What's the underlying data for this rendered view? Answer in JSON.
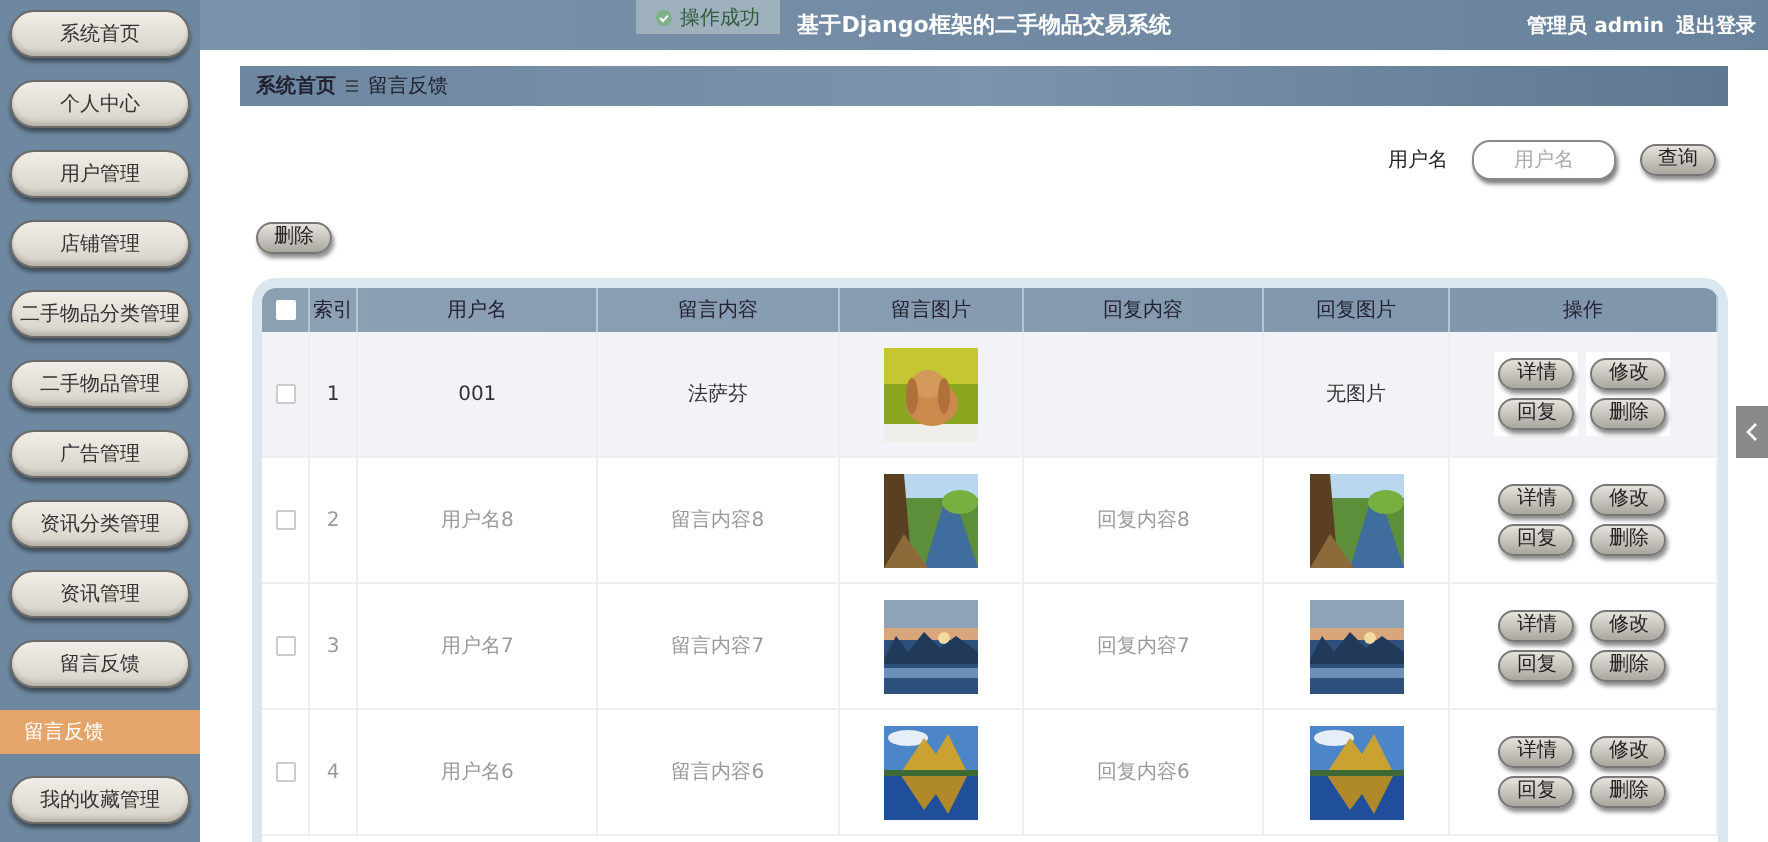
{
  "header": {
    "title": "基于Django框架的二手物品交易系统",
    "user": "管理员 admin",
    "logout": "退出登录"
  },
  "toast": {
    "text": "操作成功"
  },
  "sidebar": {
    "items": [
      {
        "label": "系统首页",
        "kind": "button",
        "selected": false
      },
      {
        "label": "个人中心",
        "kind": "button",
        "selected": false
      },
      {
        "label": "用户管理",
        "kind": "button",
        "selected": false
      },
      {
        "label": "店铺管理",
        "kind": "button",
        "selected": false
      },
      {
        "label": "二手物品分类管理",
        "kind": "button",
        "selected": false
      },
      {
        "label": "二手物品管理",
        "kind": "button",
        "selected": false
      },
      {
        "label": "广告管理",
        "kind": "button",
        "selected": false
      },
      {
        "label": "资讯分类管理",
        "kind": "button",
        "selected": false
      },
      {
        "label": "资讯管理",
        "kind": "button",
        "selected": false
      },
      {
        "label": "留言反馈",
        "kind": "button",
        "selected": false
      },
      {
        "label": "留言反馈",
        "kind": "subitem",
        "selected": true
      },
      {
        "label": "我的收藏管理",
        "kind": "button",
        "selected": false
      }
    ]
  },
  "breadcrumb": [
    "系统首页",
    "留言反馈"
  ],
  "search": {
    "label": "用户名",
    "placeholder": "用户名",
    "button": "查询"
  },
  "delete_button": "删除",
  "table": {
    "columns": [
      "索引",
      "用户名",
      "留言内容",
      "留言图片",
      "回复内容",
      "回复图片",
      "操作"
    ],
    "all_checked": false,
    "rows": [
      {
        "index": "1",
        "username": "001",
        "content": "法萨芬",
        "reply_image": {
          "kind": "none",
          "text": "无图片"
        },
        "checked": false,
        "hovered": true,
        "actions": [
          "详情",
          "修改",
          "回复",
          "删除"
        ]
      },
      {
        "index": "2",
        "username": "用户名8",
        "content": "留言内容8",
        "reply": "回复内容8",
        "checked": false,
        "hovered": false,
        "actions": [
          "详情",
          "修改",
          "回复",
          "删除"
        ]
      },
      {
        "index": "3",
        "username": "用户名7",
        "content": "留言内容7",
        "reply": "回复内容7",
        "checked": false,
        "hovered": false,
        "actions": [
          "详情",
          "修改",
          "回复",
          "删除"
        ]
      },
      {
        "index": "4",
        "username": "用户名6",
        "content": "留言内容6",
        "reply": "回复内容6",
        "checked": false,
        "hovered": false,
        "actions": [
          "详情",
          "修改",
          "回复",
          "删除"
        ]
      }
    ]
  }
}
